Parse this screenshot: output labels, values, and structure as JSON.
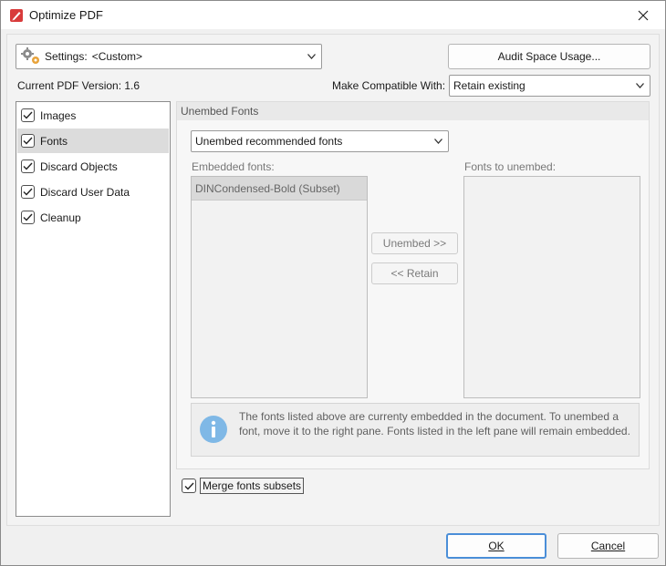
{
  "window": {
    "title": "Optimize PDF"
  },
  "settings": {
    "label": "Settings:",
    "value": "<Custom>"
  },
  "audit_button": "Audit Space Usage...",
  "pdf_version": "Current PDF Version: 1.6",
  "compat": {
    "label": "Make Compatible With:",
    "value": "Retain existing"
  },
  "nav": {
    "items": [
      {
        "label": "Images",
        "checked": true
      },
      {
        "label": "Fonts",
        "checked": true,
        "selected": true
      },
      {
        "label": "Discard Objects",
        "checked": true
      },
      {
        "label": "Discard User Data",
        "checked": true
      },
      {
        "label": "Cleanup",
        "checked": true
      }
    ]
  },
  "fonts_panel": {
    "header": "Unembed Fonts",
    "mode_value": "Unembed recommended fonts",
    "embedded_label": "Embedded fonts:",
    "embedded_fonts": [
      "DINCondensed-Bold (Subset)"
    ],
    "unembed_label": "Fonts to unembed:",
    "unembed_button": "Unembed >>",
    "retain_button": "<< Retain",
    "info_text": "The fonts listed above are currenty embedded in the document. To unembed a font, move it to the right pane. Fonts listed in the left pane will remain embedded.",
    "merge_label": "Merge fonts subsets",
    "merge_checked": true
  },
  "footer": {
    "ok": "OK",
    "cancel": "Cancel"
  },
  "colors": {
    "accent": "#4a8ed8",
    "info_icon": "#7fb8e6",
    "app_icon": "#d83b3b",
    "gear": "#e8a33a"
  }
}
